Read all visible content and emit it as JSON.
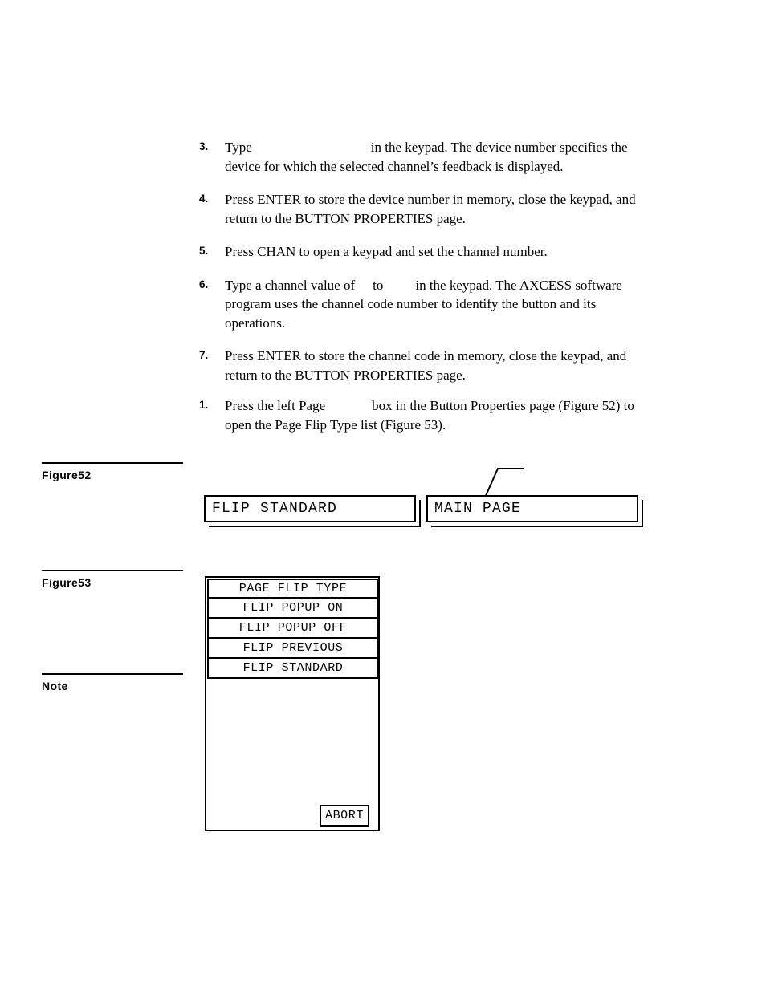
{
  "procedure_a": {
    "items": [
      {
        "number": "3.",
        "before": "Type",
        "slot": "blank-value-field",
        "after": "in the keypad. The device number specifies the device for which the selected channel’s feedback is displayed."
      },
      {
        "number": "4.",
        "before": "Press ENTER to store the device number in memory, close the keypad, and return to the BUTTON PROPERTIES page.",
        "after": ""
      },
      {
        "number": "5.",
        "before": "Press CHAN to open a keypad and set the channel number.",
        "after": ""
      },
      {
        "number": "6.",
        "before": "Type a channel value of",
        "middle": "to",
        "after": "in the keypad. The AXCESS software program uses the channel code number to identify the button and its operations."
      },
      {
        "number": "7.",
        "before": "Press ENTER to store the channel code in memory, close the keypad, and return to the BUTTON PROPERTIES page.",
        "after": ""
      }
    ]
  },
  "procedure_b": {
    "items": [
      {
        "number": "1.",
        "before": "Press the left Page",
        "after": "box in the Button Properties page (Figure 52) to open the Page Flip Type list (Figure 53)."
      }
    ]
  },
  "margin_labels": {
    "figure52": "Figure52",
    "figure53": "Figure53",
    "note": "Note"
  },
  "figure52": {
    "boxes": [
      {
        "label": "FLIP STANDARD"
      },
      {
        "label": "MAIN PAGE"
      }
    ]
  },
  "figure53": {
    "rows": [
      {
        "label": "PAGE FLIP TYPE"
      },
      {
        "label": "FLIP POPUP ON"
      },
      {
        "label": "FLIP POPUP OFF"
      },
      {
        "label": "FLIP PREVIOUS"
      },
      {
        "label": "FLIP STANDARD"
      }
    ],
    "abort_label": "ABORT"
  }
}
